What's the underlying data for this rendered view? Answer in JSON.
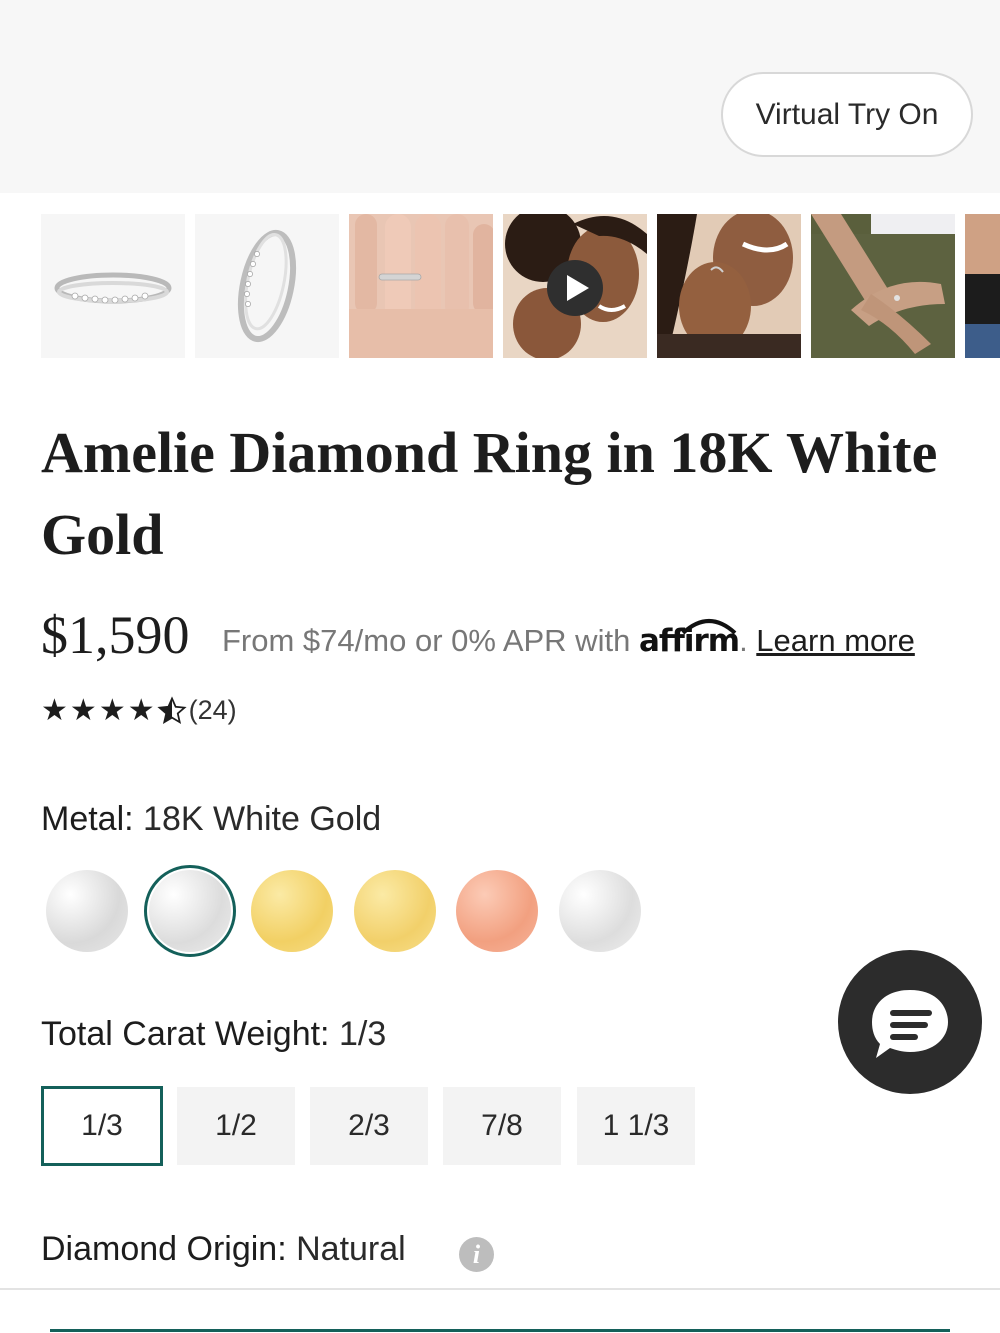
{
  "hero": {
    "virtual_try_on_label": "Virtual Try On"
  },
  "gallery": {
    "thumbnails": [
      {
        "name": "ring-flat-view"
      },
      {
        "name": "ring-side-view"
      },
      {
        "name": "ring-on-hand"
      },
      {
        "name": "model-video"
      },
      {
        "name": "model-smiling"
      },
      {
        "name": "model-arms-crossed"
      }
    ],
    "play_icon": "play-icon"
  },
  "product": {
    "title": "Amelie Diamond Ring in 18K White Gold",
    "price": "$1,590",
    "financing_prefix": "From $74/mo or 0% APR with",
    "financing_brand": "affirm",
    "learn_more": "Learn more",
    "rating_value": 4.5,
    "rating_max": 5,
    "rating_count": "(24)"
  },
  "metal": {
    "label": "Metal:",
    "value": "18K White Gold",
    "swatches": [
      {
        "name": "silver",
        "color": "#e2e2e2"
      },
      {
        "name": "white-gold",
        "color": "#e6e6e6",
        "selected": true
      },
      {
        "name": "yellow-gold-1",
        "color": "#f3d873"
      },
      {
        "name": "yellow-gold-2",
        "color": "#f5da7a"
      },
      {
        "name": "rose-gold",
        "color": "#f3a98d"
      },
      {
        "name": "platinum",
        "color": "#e6e6e6"
      }
    ]
  },
  "carat": {
    "label": "Total Carat Weight:",
    "value": "1/3",
    "options": [
      "1/3",
      "1/2",
      "2/3",
      "7/8",
      "1 1/3"
    ],
    "selected_index": 0
  },
  "origin": {
    "label": "Diamond Origin:",
    "value": "Natural",
    "info_icon": "i"
  },
  "colors": {
    "accent": "#14605a",
    "chat_bg": "#2c2c2c"
  }
}
